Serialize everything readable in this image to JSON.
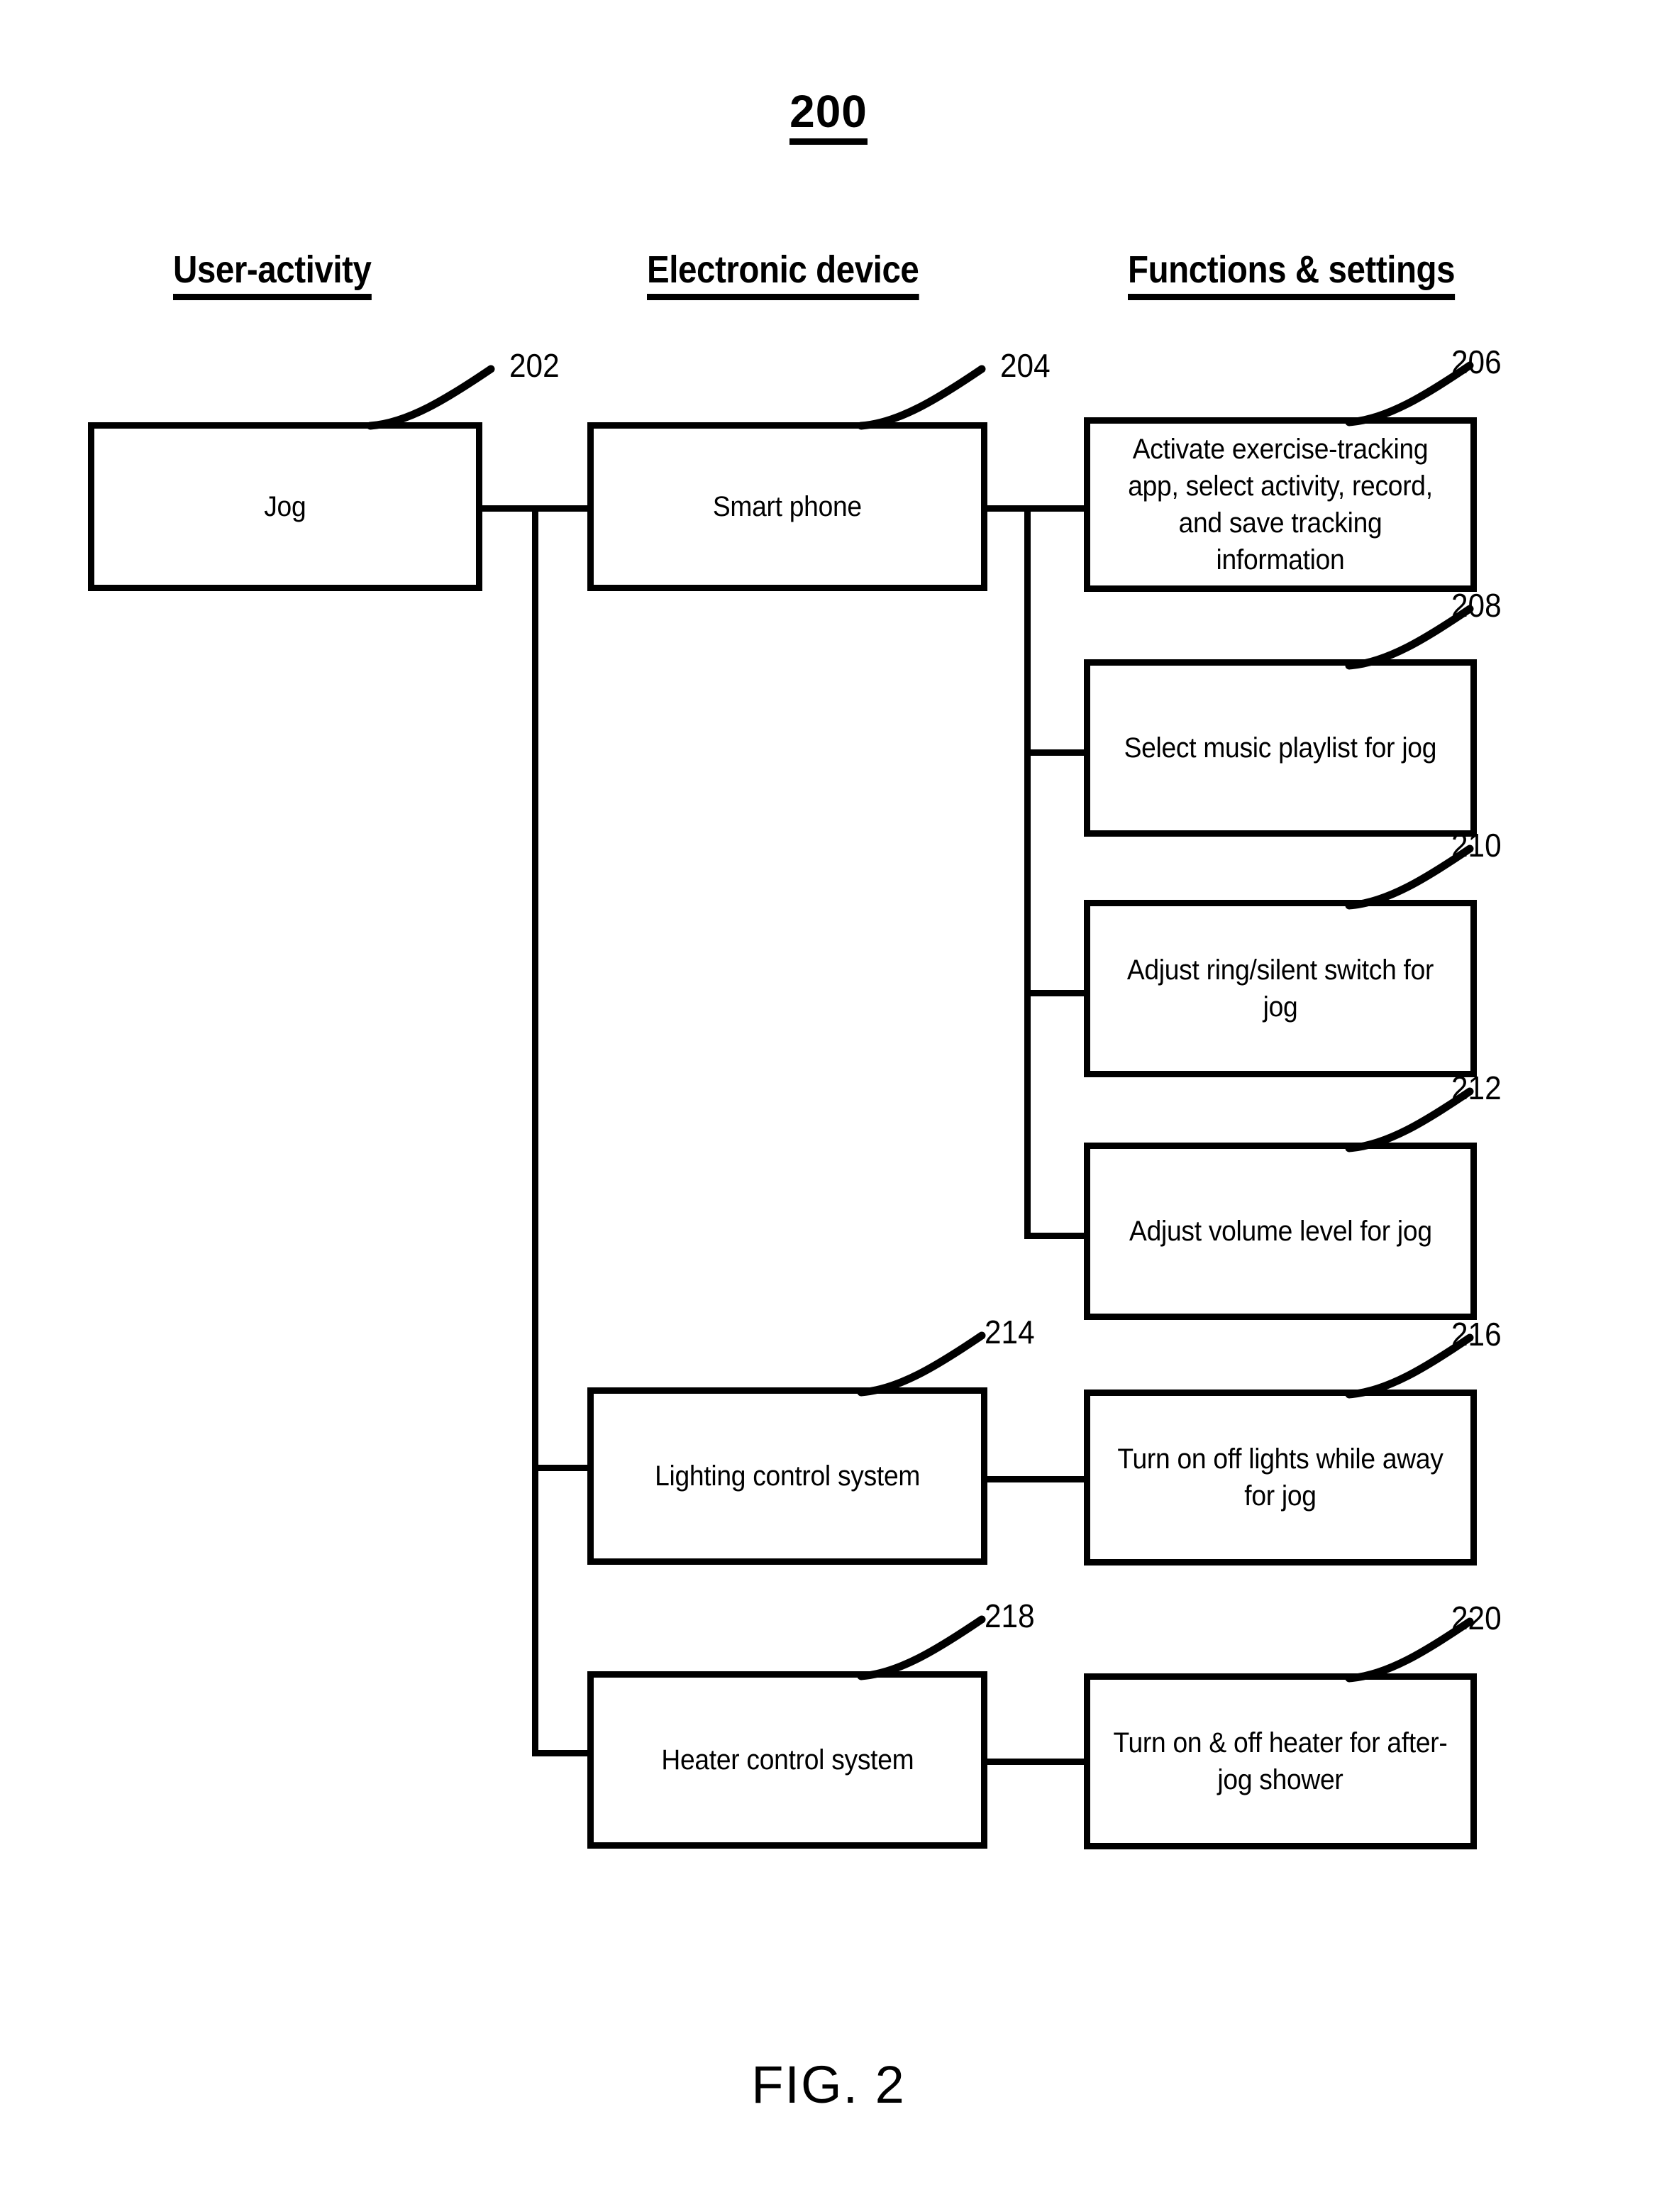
{
  "figure": {
    "number_label": "200",
    "caption": "FIG. 2"
  },
  "column_headers": [
    {
      "id": "user-activity",
      "label": "User-activity"
    },
    {
      "id": "electronic-device",
      "label": "Electronic device"
    },
    {
      "id": "functions-settings",
      "label": "Functions & settings"
    }
  ],
  "nodes": {
    "n202": {
      "ref": "202",
      "text": "Jog"
    },
    "n204": {
      "ref": "204",
      "text": "Smart phone"
    },
    "n206": {
      "ref": "206",
      "text": "Activate exercise-tracking app, select activity, record, and save tracking information"
    },
    "n208": {
      "ref": "208",
      "text": "Select music playlist for jog"
    },
    "n210": {
      "ref": "210",
      "text": "Adjust ring/silent switch for jog"
    },
    "n212": {
      "ref": "212",
      "text": "Adjust volume level for jog"
    },
    "n214": {
      "ref": "214",
      "text": "Lighting control system"
    },
    "n216": {
      "ref": "216",
      "text": "Turn on off lights while away for jog"
    },
    "n218": {
      "ref": "218",
      "text": "Heater control system"
    },
    "n220": {
      "ref": "220",
      "text": "Turn on & off heater for after-jog shower"
    }
  },
  "colors": {
    "stroke": "#000000",
    "background": "#ffffff"
  }
}
